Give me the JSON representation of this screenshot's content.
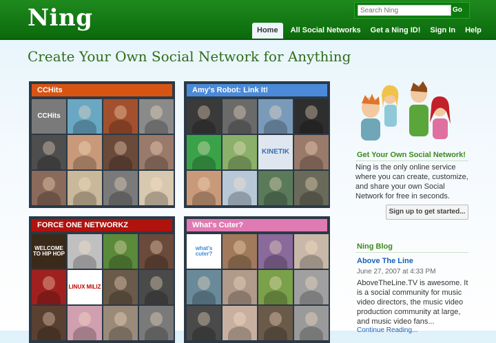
{
  "header": {
    "logo": "Ning",
    "search_placeholder": "Search Ning",
    "go_label": "Go",
    "nav": [
      "Home",
      "All Social Networks",
      "Get a Ning ID!",
      "Sign In",
      "Help"
    ]
  },
  "page_title": "Create Your Own Social Network for Anything",
  "networks": [
    {
      "title": "CCHits",
      "title_color": "#d85413",
      "thumb_texts": [
        "CCHits",
        "",
        "",
        "",
        "",
        "",
        "",
        "",
        "",
        "",
        "",
        ""
      ],
      "thumb_colors": [
        "#7a7a7a",
        "#6aa7c2",
        "#a3502f",
        "#8a8a8a",
        "#4e4e4e",
        "#c89a7a",
        "#6b4a3a",
        "#9a7a6a",
        "#8a6a5a",
        "#c9b89a",
        "#7a7a7a",
        "#d8c8b0"
      ]
    },
    {
      "title": "Amy's Robot: Link It!",
      "title_color": "#4a8ad8",
      "thumb_texts": [
        "",
        "",
        "",
        "",
        "",
        "",
        "KINETIK",
        "",
        "",
        "",
        "",
        ""
      ],
      "thumb_colors": [
        "#3a3a3a",
        "#6a6a6a",
        "#7a9aba",
        "#2e2e2e",
        "#3aa34a",
        "#8ab06a",
        "#dfe6ef",
        "#9a7a6a",
        "#c89a7a",
        "#b8c8d8",
        "#5a7a5a",
        "#6a6a5a"
      ]
    },
    {
      "title": "FORCE ONE NETWORKZ",
      "title_color": "#b0120e",
      "thumb_texts": [
        "WELCOME TO HIP HOP",
        "",
        "",
        "",
        "",
        "LINUX MILIZ",
        "",
        "",
        "",
        "",
        "",
        ""
      ],
      "thumb_colors": [
        "#3a2a1a",
        "#c0c0c0",
        "#5a8a3a",
        "#6a4a3a",
        "#a02020",
        "#ffffff",
        "#6a5a4a",
        "#4a4a4a",
        "#5a4030",
        "#d0a0b0",
        "#9a8a7a",
        "#7a7a7a"
      ]
    },
    {
      "title": "What's Cuter?",
      "title_color": "#e07ab2",
      "thumb_texts": [
        "what's cuter?",
        "",
        "",
        "",
        "",
        "",
        "",
        "",
        "",
        "",
        "",
        ""
      ],
      "thumb_colors": [
        "#ffffff",
        "#a07a5a",
        "#8a6a9a",
        "#c8b8a8",
        "#6a8a9a",
        "#b09a8a",
        "#7aa04a",
        "#a0a0a0",
        "#4a4a4a",
        "#c8b0a0",
        "#6a5a4a",
        "#9a9a9a"
      ]
    }
  ],
  "sidebar": {
    "get_heading": "Get Your Own Social Network!",
    "get_text": "Ning is the only online service where you can create, customize, and share your own Social Network for free in seconds.",
    "signup_label": "Sign up to get started...",
    "blog_heading": "Ning Blog",
    "blog_post_title": "Above The Line",
    "blog_post_date": "June 27, 2007 at 4:33 PM",
    "blog_post_text": "AboveTheLine.TV is awesome. It is a social community for music video directors, the music video production community at large, and music video fans...",
    "continue_link": "Continue Reading..."
  }
}
